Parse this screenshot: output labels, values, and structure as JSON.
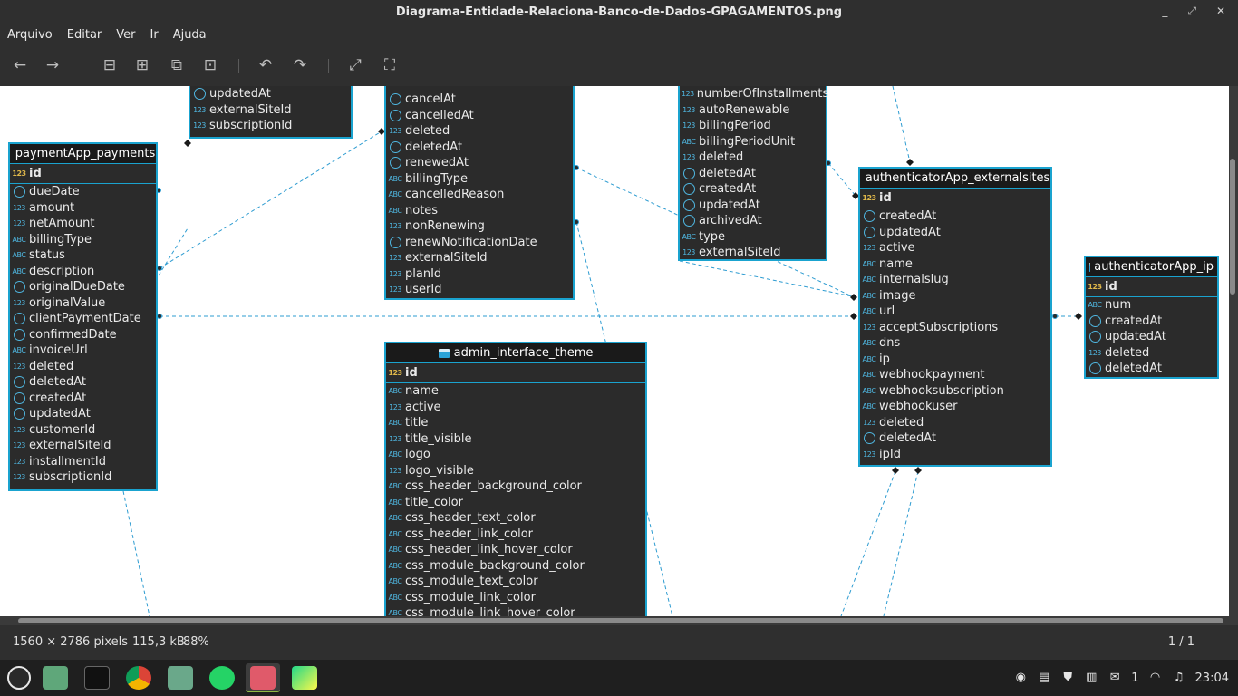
{
  "window": {
    "title": "Diagrama-Entidade-Relaciona-Banco-de-Dados-GPAGAMENTOS.png"
  },
  "menu": [
    "Arquivo",
    "Editar",
    "Ver",
    "Ir",
    "Ajuda"
  ],
  "status": {
    "dimensions": "1560 × 2786 pixels",
    "filesize": "115,3 kB",
    "zoom": "88%",
    "page": "1 / 1"
  },
  "clock": "23:04",
  "tray_count": "1",
  "tables": {
    "subscriptions_top": {
      "rows": [
        {
          "t": "clk",
          "n": "updatedAt"
        },
        {
          "t": "fk",
          "n": "externalSiteId"
        },
        {
          "t": "fk",
          "n": "subscriptionId"
        }
      ]
    },
    "payments": {
      "name": "paymentApp_payments",
      "pk": "id",
      "rows": [
        {
          "t": "clk",
          "n": "dueDate"
        },
        {
          "t": "123",
          "n": "amount"
        },
        {
          "t": "123",
          "n": "netAmount"
        },
        {
          "t": "abc",
          "n": "billingType"
        },
        {
          "t": "abc",
          "n": "status"
        },
        {
          "t": "abc",
          "n": "description"
        },
        {
          "t": "clk",
          "n": "originalDueDate"
        },
        {
          "t": "123",
          "n": "originalValue"
        },
        {
          "t": "clk",
          "n": "clientPaymentDate"
        },
        {
          "t": "clk",
          "n": "confirmedDate"
        },
        {
          "t": "abc",
          "n": "invoiceUrl"
        },
        {
          "t": "123",
          "n": "deleted"
        },
        {
          "t": "clk",
          "n": "deletedAt"
        },
        {
          "t": "clk",
          "n": "createdAt"
        },
        {
          "t": "clk",
          "n": "updatedAt"
        },
        {
          "t": "fk",
          "n": "customerId"
        },
        {
          "t": "fk",
          "n": "externalSiteId"
        },
        {
          "t": "fk",
          "n": "installmentId"
        },
        {
          "t": "fk",
          "n": "subscriptionId"
        }
      ]
    },
    "subscriptions_mid": {
      "rows": [
        {
          "t": "clk",
          "n": "cancelAt"
        },
        {
          "t": "clk",
          "n": "cancelledAt"
        },
        {
          "t": "123",
          "n": "deleted"
        },
        {
          "t": "clk",
          "n": "deletedAt"
        },
        {
          "t": "clk",
          "n": "renewedAt"
        },
        {
          "t": "abc",
          "n": "billingType"
        },
        {
          "t": "abc",
          "n": "cancelledReason"
        },
        {
          "t": "abc",
          "n": "notes"
        },
        {
          "t": "123",
          "n": "nonRenewing"
        },
        {
          "t": "clk",
          "n": "renewNotificationDate"
        },
        {
          "t": "fk",
          "n": "externalSiteId"
        },
        {
          "t": "fk",
          "n": "planId"
        },
        {
          "t": "fk",
          "n": "userId"
        }
      ]
    },
    "plans": {
      "rows": [
        {
          "t": "123",
          "n": "numberOfInstallments"
        },
        {
          "t": "123",
          "n": "autoRenewable"
        },
        {
          "t": "123",
          "n": "billingPeriod"
        },
        {
          "t": "abc",
          "n": "billingPeriodUnit"
        },
        {
          "t": "123",
          "n": "deleted"
        },
        {
          "t": "clk",
          "n": "deletedAt"
        },
        {
          "t": "clk",
          "n": "createdAt"
        },
        {
          "t": "clk",
          "n": "updatedAt"
        },
        {
          "t": "clk",
          "n": "archivedAt"
        },
        {
          "t": "abc",
          "n": "type"
        },
        {
          "t": "fk",
          "n": "externalSiteId"
        }
      ]
    },
    "externalsites": {
      "name": "authenticatorApp_externalsites",
      "pk": "id",
      "rows": [
        {
          "t": "clk",
          "n": "createdAt"
        },
        {
          "t": "clk",
          "n": "updatedAt"
        },
        {
          "t": "123",
          "n": "active"
        },
        {
          "t": "abc",
          "n": "name"
        },
        {
          "t": "abc",
          "n": "internalslug"
        },
        {
          "t": "abc",
          "n": "image"
        },
        {
          "t": "abc",
          "n": "url"
        },
        {
          "t": "123",
          "n": "acceptSubscriptions"
        },
        {
          "t": "abc",
          "n": "dns"
        },
        {
          "t": "abc",
          "n": "ip"
        },
        {
          "t": "abc",
          "n": "webhookpayment"
        },
        {
          "t": "abc",
          "n": "webhooksubscription"
        },
        {
          "t": "abc",
          "n": "webhookuser"
        },
        {
          "t": "123",
          "n": "deleted"
        },
        {
          "t": "clk",
          "n": "deletedAt"
        },
        {
          "t": "fk",
          "n": "ipId"
        }
      ]
    },
    "ip": {
      "name": "authenticatorApp_ip",
      "pk": "id",
      "rows": [
        {
          "t": "abc",
          "n": "num"
        },
        {
          "t": "clk",
          "n": "createdAt"
        },
        {
          "t": "clk",
          "n": "updatedAt"
        },
        {
          "t": "123",
          "n": "deleted"
        },
        {
          "t": "clk",
          "n": "deletedAt"
        }
      ]
    },
    "theme": {
      "name": "admin_interface_theme",
      "pk": "id",
      "rows": [
        {
          "t": "abc",
          "n": "name"
        },
        {
          "t": "123",
          "n": "active"
        },
        {
          "t": "abc",
          "n": "title"
        },
        {
          "t": "123",
          "n": "title_visible"
        },
        {
          "t": "abc",
          "n": "logo"
        },
        {
          "t": "123",
          "n": "logo_visible"
        },
        {
          "t": "abc",
          "n": "css_header_background_color"
        },
        {
          "t": "abc",
          "n": "title_color"
        },
        {
          "t": "abc",
          "n": "css_header_text_color"
        },
        {
          "t": "abc",
          "n": "css_header_link_color"
        },
        {
          "t": "abc",
          "n": "css_header_link_hover_color"
        },
        {
          "t": "abc",
          "n": "css_module_background_color"
        },
        {
          "t": "abc",
          "n": "css_module_text_color"
        },
        {
          "t": "abc",
          "n": "css_module_link_color"
        },
        {
          "t": "abc",
          "n": "css_module_link_hover_color"
        }
      ]
    }
  }
}
